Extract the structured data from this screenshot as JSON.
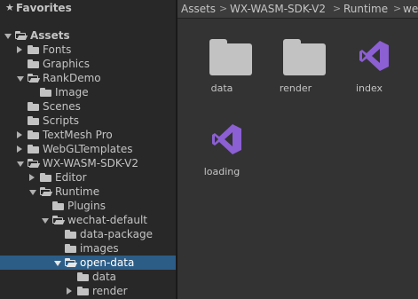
{
  "favorites": {
    "label": "Favorites"
  },
  "tree": [
    {
      "label": "Assets",
      "arrow": "down",
      "folder": "open",
      "bold": true
    },
    {
      "label": "Fonts",
      "arrow": "right",
      "folder": "closed"
    },
    {
      "label": "Graphics",
      "arrow": "none",
      "folder": "closed"
    },
    {
      "label": "RankDemo",
      "arrow": "down",
      "folder": "open"
    },
    {
      "label": "Image",
      "arrow": "none",
      "folder": "closed"
    },
    {
      "label": "Scenes",
      "arrow": "none",
      "folder": "closed"
    },
    {
      "label": "Scripts",
      "arrow": "none",
      "folder": "closed"
    },
    {
      "label": "TextMesh Pro",
      "arrow": "right",
      "folder": "closed"
    },
    {
      "label": "WebGLTemplates",
      "arrow": "right",
      "folder": "closed"
    },
    {
      "label": "WX-WASM-SDK-V2",
      "arrow": "down",
      "folder": "open"
    },
    {
      "label": "Editor",
      "arrow": "right",
      "folder": "closed"
    },
    {
      "label": "Runtime",
      "arrow": "down",
      "folder": "open"
    },
    {
      "label": "Plugins",
      "arrow": "none",
      "folder": "closed"
    },
    {
      "label": "wechat-default",
      "arrow": "down",
      "folder": "open"
    },
    {
      "label": "data-package",
      "arrow": "none",
      "folder": "closed"
    },
    {
      "label": "images",
      "arrow": "none",
      "folder": "closed"
    },
    {
      "label": "open-data",
      "arrow": "down",
      "folder": "open",
      "selected": true
    },
    {
      "label": "data",
      "arrow": "none",
      "folder": "closed"
    },
    {
      "label": "render",
      "arrow": "right",
      "folder": "closed"
    }
  ],
  "breadcrumb": [
    "Assets",
    "WX-WASM-SDK-V2",
    "Runtime",
    "we"
  ],
  "files": [
    {
      "name": "data",
      "icon": "folder-icon"
    },
    {
      "name": "render",
      "icon": "folder-icon"
    },
    {
      "name": "index",
      "icon": "visual-studio-icon"
    },
    {
      "name": "loading",
      "icon": "visual-studio-icon"
    }
  ],
  "colors": {
    "selection": "#2c5d87",
    "vs_purple": "#8c5fd3"
  }
}
